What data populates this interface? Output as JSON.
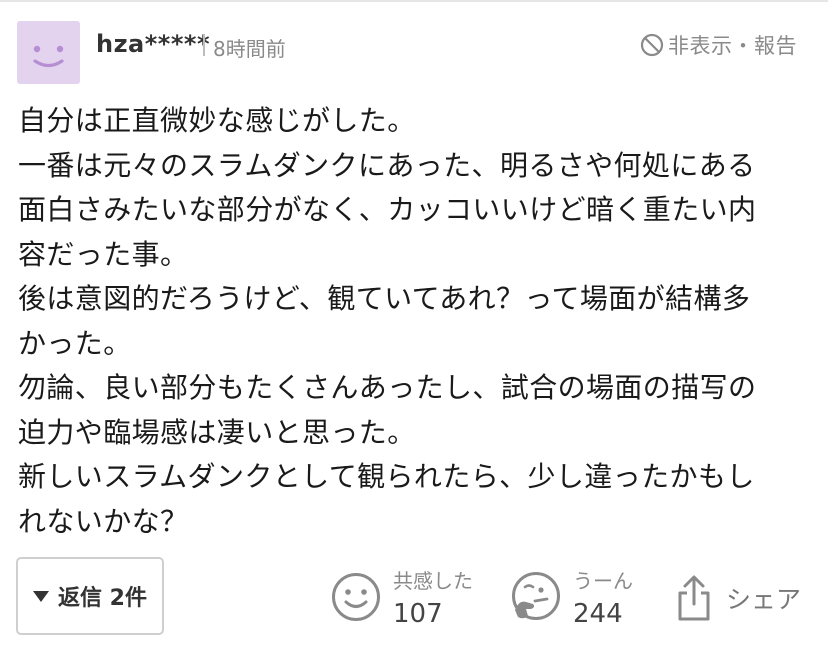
{
  "user": {
    "name": "hza*****",
    "time": "8時間前",
    "avatar_icon": "smiley-face-icon",
    "avatar_color": "#e3d3ee"
  },
  "report": {
    "icon": "prohibited-icon",
    "label": "非表示・報告"
  },
  "comment": {
    "lines": [
      "自分は正直微妙な感じがした。",
      "一番は元々のスラムダンクにあった、明るさや何処にある",
      "面白さみたいな部分がなく、カッコいいけど暗く重たい内",
      "容だった事。",
      "後は意図的だろうけど、観ていてあれ？って場面が結構多",
      "かった。",
      "勿論、良い部分もたくさんあったし、試合の場面の描写の",
      "迫力や臨場感は凄いと思った。",
      "新しいスラムダンクとして観られたら、少し違ったかもし",
      "れないかな？"
    ]
  },
  "actions": {
    "reply_label": "返信 2件",
    "empathy": {
      "label": "共感した",
      "count": "107",
      "icon": "smile-icon"
    },
    "hmm": {
      "label": "うーん",
      "count": "244",
      "icon": "thinking-face-icon"
    },
    "share": {
      "label": "シェア",
      "icon": "share-icon"
    }
  }
}
